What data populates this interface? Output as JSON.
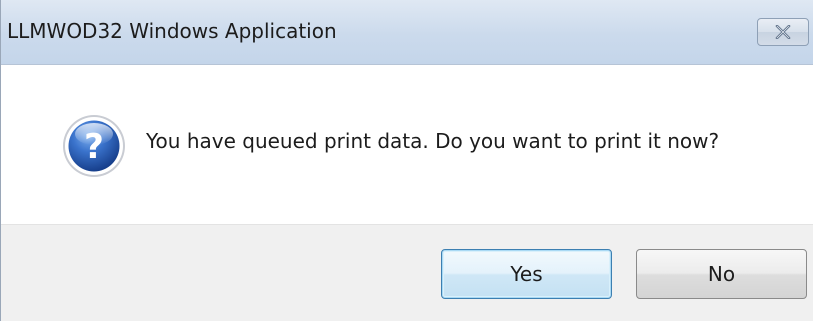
{
  "window": {
    "title": "LLMWOD32 Windows Application",
    "close_icon": "close-icon"
  },
  "dialog": {
    "icon": "question-icon",
    "message": "You have queued print data. Do you want to print it now?"
  },
  "buttons": {
    "yes_label": "Yes",
    "no_label": "No"
  },
  "colors": {
    "titlebar": "#cbdaec",
    "footer": "#f0f0f0",
    "default_button_border": "#3c7fb1",
    "icon_blue": "#2a5db0"
  }
}
